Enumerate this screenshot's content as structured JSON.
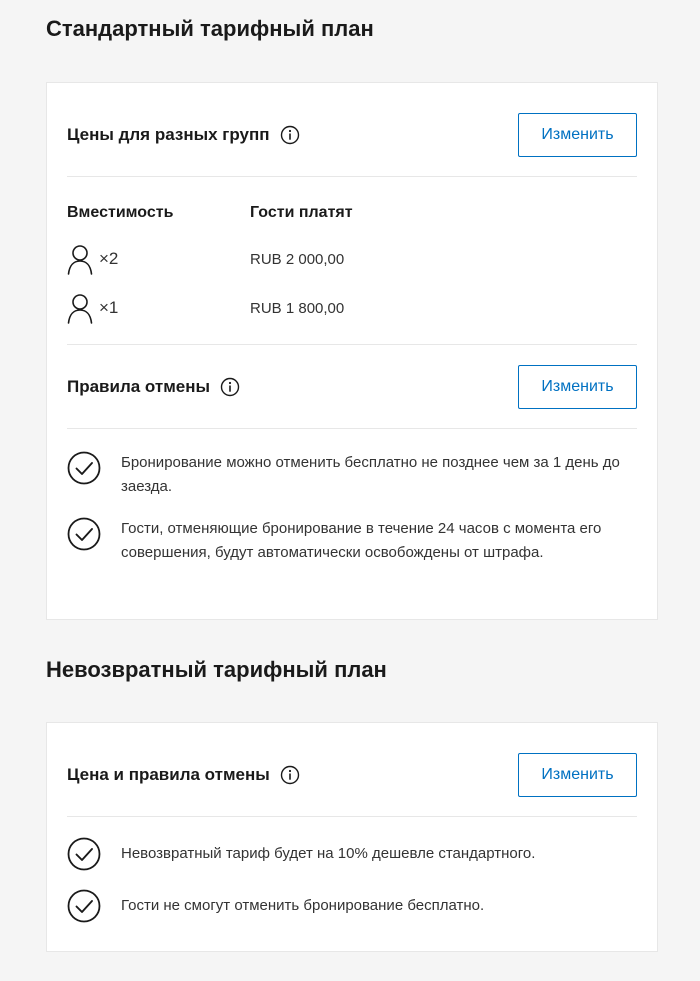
{
  "standard": {
    "title": "Стандартный тарифный план",
    "pricing": {
      "label": "Цены для разных групп",
      "edit_label": "Изменить",
      "col_occupancy": "Вместимость",
      "col_price": "Гости платят",
      "rows": [
        {
          "multiplier": "×2",
          "price": "RUB 2 000,00"
        },
        {
          "multiplier": "×1",
          "price": "RUB 1 800,00"
        }
      ]
    },
    "cancellation": {
      "label": "Правила отмены",
      "edit_label": "Изменить",
      "rules": [
        "Бронирование можно отменить бесплатно не позднее чем за 1 день до заезда.",
        "Гости, отменяющие бронирование в течение 24 часов с момента его совершения, будут автоматически освобождены от штрафа."
      ]
    }
  },
  "nonrefundable": {
    "title": "Невозвратный тарифный план",
    "label": "Цена и правила отмены",
    "edit_label": "Изменить",
    "rules": [
      "Невозвратный тариф будет на 10% дешевле стандартного.",
      "Гости не смогут отменить бронирование бесплатно."
    ]
  },
  "colors": {
    "accent": "#0071c2",
    "background": "#f5f5f5",
    "card": "#ffffff"
  },
  "icons": {
    "info": "info-icon",
    "person": "person-icon",
    "check": "check-circle-icon"
  }
}
